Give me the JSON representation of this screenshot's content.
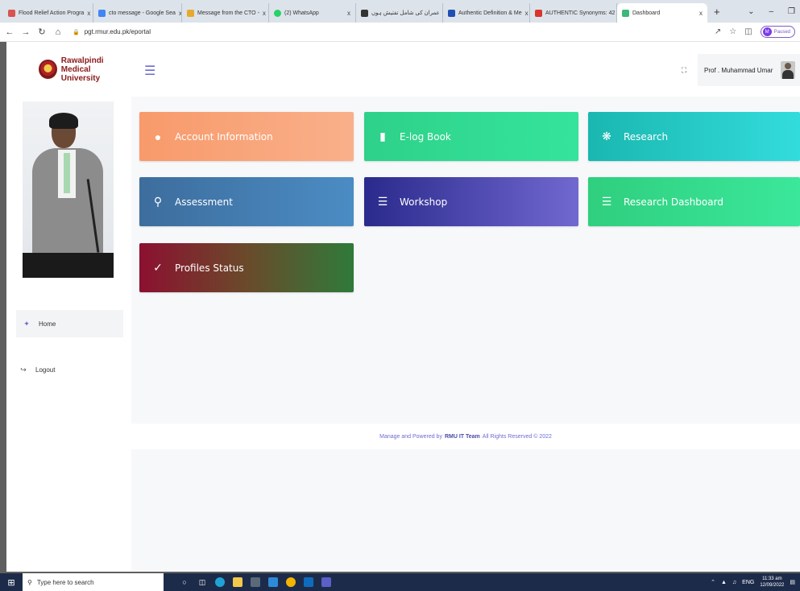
{
  "browser": {
    "tabs": [
      {
        "label": "Flood Relief Action Progra",
        "fav_color": "#d9534f"
      },
      {
        "label": "cto message - Google Sea",
        "fav_color": "#4285f4"
      },
      {
        "label": "Message from the CTO - ",
        "fav_color": "#e7a92d"
      },
      {
        "label": "(2) WhatsApp",
        "fav_color": "#25d366"
      },
      {
        "label": "عمران کی شامل تفتیش ہوں",
        "fav_color": "#333333"
      },
      {
        "label": "Authentic Definition & Me",
        "fav_color": "#1f4fb4"
      },
      {
        "label": "AUTHENTIC Synonyms: 42",
        "fav_color": "#d9362b"
      },
      {
        "label": "Dashboard",
        "fav_color": "#3cb878"
      }
    ],
    "tab_close": "x",
    "new_tab": "+",
    "url": "pgt.rmur.edu.pk/eportal",
    "profile_initial": "M",
    "paused_label": "Paused"
  },
  "header": {
    "logo_line1": "Rawalpindi Medical",
    "logo_line2": "University",
    "user_name": "Prof . Muhammad Umar"
  },
  "sidebar": {
    "items": [
      {
        "label": "Home",
        "icon": "home-icon"
      },
      {
        "label": "Logout",
        "icon": "logout-icon"
      }
    ]
  },
  "tiles": [
    {
      "label": "Account Information",
      "icon": "user-icon"
    },
    {
      "label": "E-log Book",
      "icon": "book-icon"
    },
    {
      "label": "Research",
      "icon": "gear-icon"
    },
    {
      "label": "Assessment",
      "icon": "award-icon"
    },
    {
      "label": "Workshop",
      "icon": "list-icon"
    },
    {
      "label": "Research Dashboard",
      "icon": "list-icon"
    },
    {
      "label": "Profiles Status",
      "icon": "user-check-icon"
    }
  ],
  "footer": {
    "prefix": "Manage and Powered by",
    "team": "RMU IT Team",
    "suffix": "All Rights Reserved © 2022"
  },
  "taskbar": {
    "search_placeholder": "Type here to search",
    "lang": "ENG",
    "time": "11:33 am",
    "date": "12/09/2022"
  }
}
